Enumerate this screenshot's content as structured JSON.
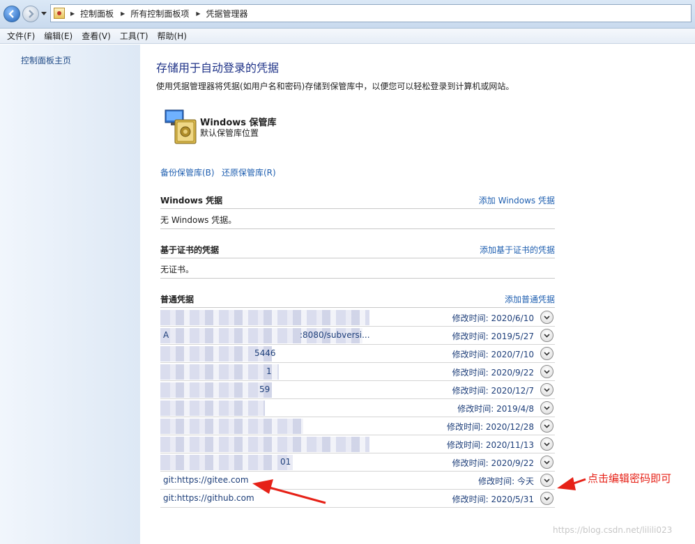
{
  "breadcrumb": [
    "控制面板",
    "所有控制面板项",
    "凭据管理器"
  ],
  "menu": [
    "文件(F)",
    "编辑(E)",
    "查看(V)",
    "工具(T)",
    "帮助(H)"
  ],
  "sidebar": {
    "home_link": "控制面板主页"
  },
  "main": {
    "title": "存储用于自动登录的凭据",
    "description": "使用凭据管理器将凭据(如用户名和密码)存储到保管库中，以便您可以轻松登录到计算机或网站。",
    "vault": {
      "title": "Windows 保管库",
      "subtitle": "默认保管库位置"
    },
    "backup_link": "备份保管库(B)",
    "restore_link": "还原保管库(R)"
  },
  "windows_credentials": {
    "title": "Windows 凭据",
    "add_link": "添加 Windows 凭据",
    "empty_text": "无 Windows 凭据。"
  },
  "certificate_credentials": {
    "title": "基于证书的凭据",
    "add_link": "添加基于证书的凭据",
    "empty_text": "无证书。"
  },
  "generic_credentials": {
    "title": "普通凭据",
    "add_link": "添加普通凭据",
    "modified_label": "修改时间:",
    "rows": [
      {
        "name": "",
        "date": "2020/6/10",
        "blurred": true
      },
      {
        "name": "A",
        "name_tail": ":8080/subversi...",
        "date": "2019/5/27",
        "blurred": true
      },
      {
        "name": "",
        "name_tail": "5446",
        "date": "2020/7/10",
        "blurred": true
      },
      {
        "name": "",
        "name_tail": "1",
        "date": "2020/9/22",
        "blurred": true
      },
      {
        "name": "",
        "name_tail": "59",
        "date": "2020/12/7",
        "blurred": true
      },
      {
        "name": "",
        "date": "2019/4/8",
        "blurred": true
      },
      {
        "name": "",
        "date": "2020/12/28",
        "blurred": true
      },
      {
        "name": "",
        "date": "2020/11/13",
        "blurred": true
      },
      {
        "name": "",
        "name_tail": "01",
        "date": "2020/9/22",
        "blurred": true
      },
      {
        "name": "git:https://gitee.com",
        "date": "今天",
        "blurred": false
      },
      {
        "name": "git:https://github.com",
        "date": "2020/5/31",
        "blurred": false
      }
    ]
  },
  "annotation": {
    "text": "点击编辑密码即可",
    "color": "#e62117"
  },
  "watermark": "https://blog.csdn.net/lilili023"
}
